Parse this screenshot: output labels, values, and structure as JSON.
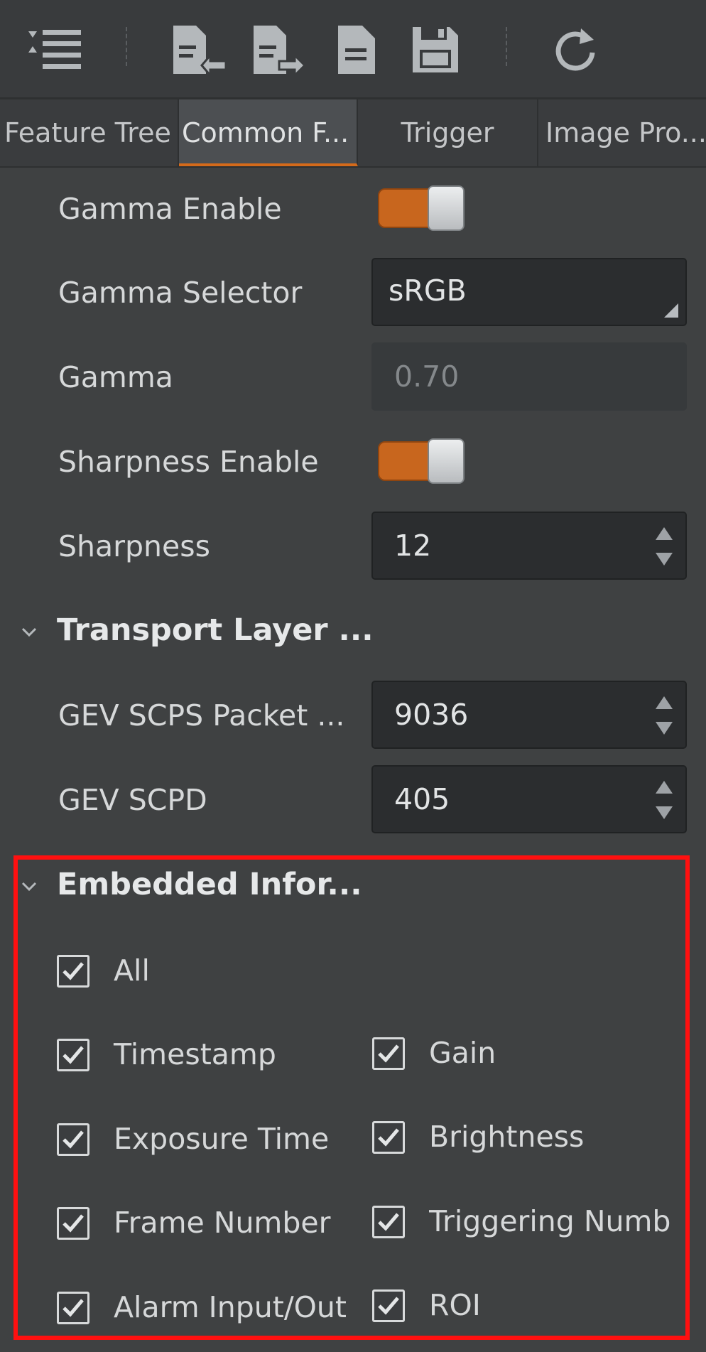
{
  "toolbar": {
    "icons": [
      "list-collapse-icon",
      "import-file-icon",
      "export-file-icon",
      "document-icon",
      "save-icon",
      "refresh-icon"
    ]
  },
  "tabs": [
    {
      "label": "Feature Tree",
      "active": false
    },
    {
      "label": "Common F...",
      "active": true
    },
    {
      "label": "Trigger",
      "active": false
    },
    {
      "label": "Image Pro...",
      "active": false
    }
  ],
  "properties": {
    "gamma_enable": {
      "label": "Gamma Enable",
      "on": true
    },
    "gamma_selector": {
      "label": "Gamma Selector",
      "value": "sRGB"
    },
    "gamma": {
      "label": "Gamma",
      "value": "0.70"
    },
    "sharpness_enable": {
      "label": "Sharpness Enable",
      "on": true
    },
    "sharpness": {
      "label": "Sharpness",
      "value": "12"
    }
  },
  "transport": {
    "title": "Transport Layer ...",
    "packet": {
      "label": "GEV SCPS Packet ...",
      "value": "9036"
    },
    "scpd": {
      "label": "GEV SCPD",
      "value": "405"
    }
  },
  "embedded": {
    "title": "Embedded Infor...",
    "all": {
      "label": "All",
      "checked": true
    },
    "items_left": [
      {
        "label": "Timestamp",
        "checked": true
      },
      {
        "label": "Exposure Time",
        "checked": true
      },
      {
        "label": "Frame Number",
        "checked": true
      },
      {
        "label": "Alarm Input/Out",
        "checked": true
      }
    ],
    "items_right": [
      {
        "label": "Gain",
        "checked": true
      },
      {
        "label": "Brightness",
        "checked": true
      },
      {
        "label": "Triggering Numb",
        "checked": true
      },
      {
        "label": "ROI",
        "checked": true
      }
    ]
  },
  "colors": {
    "accent": "#d46a1a",
    "highlight": "#ff1010",
    "background": "#3f4142"
  }
}
